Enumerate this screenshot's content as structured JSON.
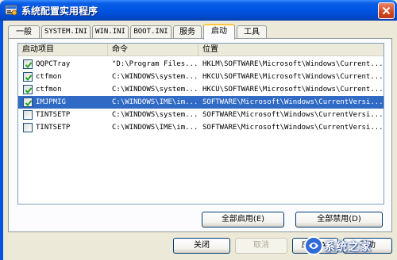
{
  "window": {
    "title": "系统配置实用程序"
  },
  "tabs": [
    {
      "label": "一般"
    },
    {
      "label": "SYSTEM.INI"
    },
    {
      "label": "WIN.INI"
    },
    {
      "label": "BOOT.INI"
    },
    {
      "label": "服务"
    },
    {
      "label": "启动",
      "active": true
    },
    {
      "label": "工具"
    }
  ],
  "list": {
    "headers": [
      "启动项目",
      "命令",
      "位置"
    ],
    "rows": [
      {
        "checked": true,
        "item": "QQPCTray",
        "command": "\"D:\\Program Files...",
        "location": "HKLM\\SOFTWARE\\Microsoft\\Windows\\Current...",
        "selected": false
      },
      {
        "checked": true,
        "item": "ctfmon",
        "command": "C:\\WINDOWS\\system...",
        "location": "HKCU\\SOFTWARE\\Microsoft\\Windows\\Current...",
        "selected": false
      },
      {
        "checked": true,
        "item": "ctfmon",
        "command": "C:\\WINDOWS\\system...",
        "location": "HKCU\\SOFTWARE\\Microsoft\\Windows\\Current...",
        "selected": false
      },
      {
        "checked": true,
        "item": "IMJPMIG",
        "command": "C:\\WINDOWS\\IME\\im...",
        "location": "SOFTWARE\\Microsoft\\Windows\\CurrentVersi...",
        "selected": true
      },
      {
        "checked": false,
        "item": "TINTSETP",
        "command": "C:\\WINDOWS\\system...",
        "location": "SOFTWARE\\Microsoft\\Windows\\CurrentVersi...",
        "selected": false
      },
      {
        "checked": false,
        "item": "TINTSETP",
        "command": "C:\\WINDOWS\\IME\\im...",
        "location": "SOFTWARE\\Microsoft\\Windows\\CurrentVersi...",
        "selected": false
      }
    ]
  },
  "panel_buttons": {
    "enable_all": "全部启用(E)",
    "disable_all": "全部禁用(D)"
  },
  "footer_buttons": {
    "close": "关闭",
    "cancel": "取消",
    "apply": "应用(A)",
    "help": "帮助"
  },
  "watermark": {
    "text": "系统之家"
  },
  "colors": {
    "titlebar": "#0054E3",
    "selection": "#316AC5",
    "face": "#ECE9D8",
    "active_tab_accent": "#FFC83C"
  }
}
